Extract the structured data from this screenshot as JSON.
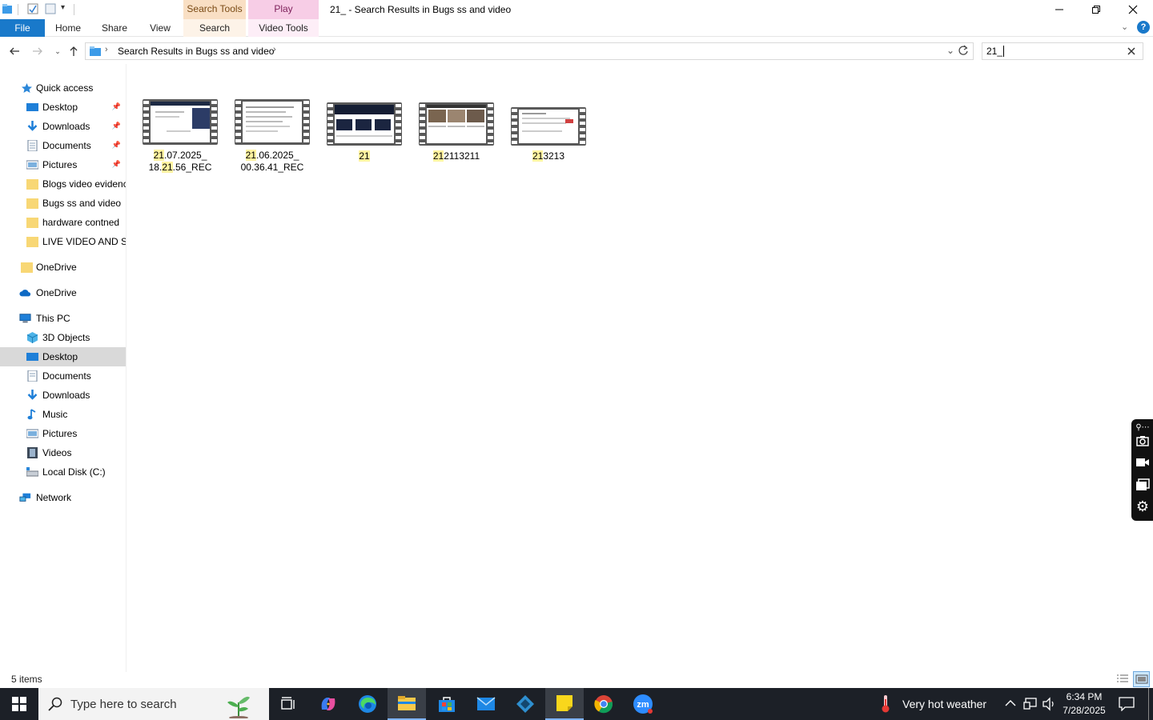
{
  "window": {
    "title": "21_ - Search Results in Bugs ss and  video",
    "context_tabs": {
      "search_tools": "Search Tools",
      "play": "Play"
    }
  },
  "ribbon": {
    "tabs": [
      "File",
      "Home",
      "Share",
      "View",
      "Search",
      "Video Tools"
    ]
  },
  "address": {
    "path": "Search Results in Bugs ss and  video",
    "search_value": "21_"
  },
  "sidebar": {
    "quick_access": "Quick access",
    "quick_items": [
      {
        "label": "Desktop",
        "pinned": true
      },
      {
        "label": "Downloads",
        "pinned": true
      },
      {
        "label": "Documents",
        "pinned": true
      },
      {
        "label": "Pictures",
        "pinned": true
      },
      {
        "label": "Blogs video evidence",
        "pinned": false
      },
      {
        "label": "Bugs ss and  video",
        "pinned": false
      },
      {
        "label": "hardware contned",
        "pinned": false
      },
      {
        "label": "LIVE VIDEO AND SS",
        "pinned": false
      }
    ],
    "onedrive_1": "OneDrive",
    "onedrive_2": "OneDrive",
    "this_pc": "This PC",
    "pc_items": [
      "3D Objects",
      "Desktop",
      "Documents",
      "Downloads",
      "Music",
      "Pictures",
      "Videos",
      "Local Disk (C:)"
    ],
    "network": "Network"
  },
  "files": [
    {
      "pre": "",
      "hl": "21",
      "mid": ".07.2025_",
      "line2_pre": "18.",
      "line2_hl": "21",
      "line2_post": ".56_REC"
    },
    {
      "pre": "",
      "hl": "21",
      "mid": ".06.2025_",
      "line2_pre": "00.36.41_REC",
      "line2_hl": "",
      "line2_post": ""
    },
    {
      "pre": "",
      "hl": "21",
      "mid": "",
      "line2_pre": "",
      "line2_hl": "",
      "line2_post": ""
    },
    {
      "pre": "",
      "hl": "21",
      "mid": "2113211",
      "line2_pre": "",
      "line2_hl": "",
      "line2_post": ""
    },
    {
      "pre": "",
      "hl": "21",
      "mid": "3213",
      "line2_pre": "",
      "line2_hl": "",
      "line2_post": ""
    }
  ],
  "status": {
    "count": "5 items"
  },
  "taskbar": {
    "search_placeholder": "Type here to search",
    "weather": "Very hot weather",
    "time": "6:34 PM",
    "date": "7/28/2025"
  },
  "colors": {
    "accent": "#1979ca",
    "search_tools_tab": "#f9dfc4",
    "play_tab": "#f7cde6",
    "selected_nav": "#cce8ff",
    "taskbar": "#1c2027",
    "match_highlight": "#fff3a0"
  }
}
